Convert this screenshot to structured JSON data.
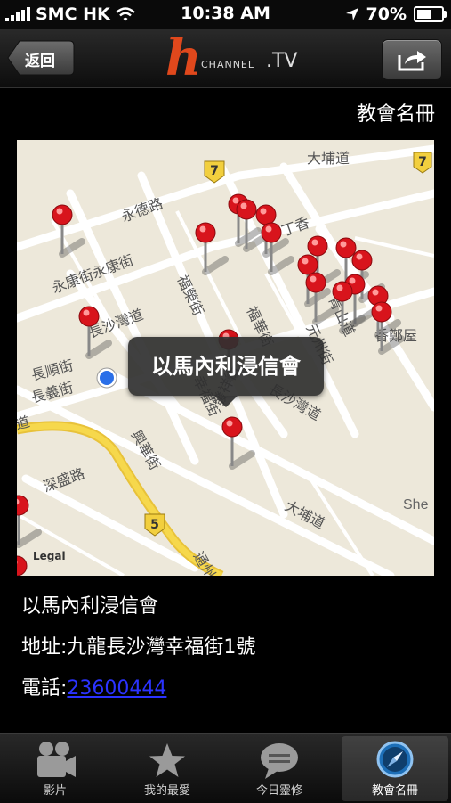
{
  "status_bar": {
    "carrier": "SMC HK",
    "time": "10:38 AM",
    "battery": "70%",
    "battery_level": 0.7
  },
  "nav": {
    "back_label": "返回",
    "logo_text": "CHANNEL",
    "logo_suffix": ".TV",
    "share_icon": "share-icon"
  },
  "page": {
    "title": "教會名冊"
  },
  "map": {
    "callout": "以馬內利浸信會",
    "legal": "Legal",
    "streets": [
      "大埔道",
      "永德路",
      "永康街",
      "永康街",
      "福榮街",
      "長沙灣道",
      "長順街",
      "長義街",
      "福華街",
      "元州街",
      "青山道",
      "幸福街",
      "發祥街",
      "長沙灣道",
      "興華街",
      "深盛路",
      "大埔道",
      "通州街",
      "She",
      "香鄭屋",
      "丁香"
    ],
    "route_shields": [
      "7",
      "7",
      "5"
    ]
  },
  "details": {
    "name": "以馬內利浸信會",
    "address": "地址:九龍長沙灣幸福街1號",
    "phone_label": "電話:",
    "phone": "23600444"
  },
  "tabs": [
    {
      "label": "影片",
      "icon": "video-camera-icon",
      "active": false
    },
    {
      "label": "我的最愛",
      "icon": "star-icon",
      "active": false
    },
    {
      "label": "今日靈修",
      "icon": "speech-bubble-icon",
      "active": false
    },
    {
      "label": "教會名冊",
      "icon": "compass-icon",
      "active": true
    }
  ]
}
